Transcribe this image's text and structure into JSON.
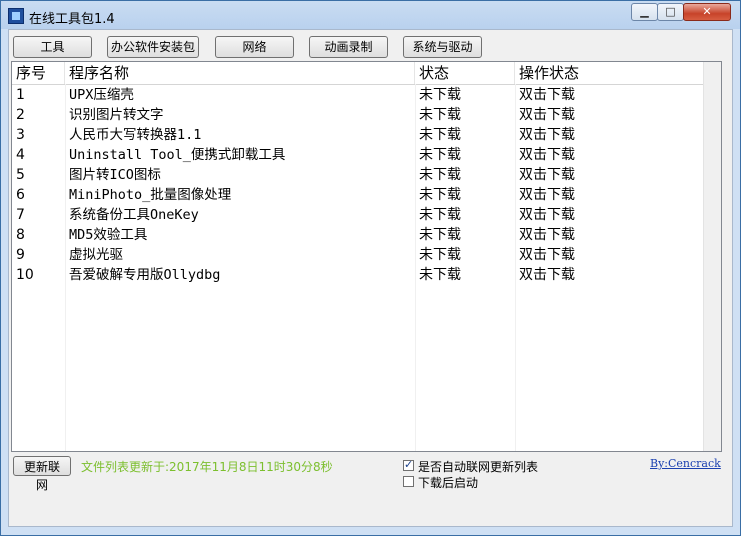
{
  "window": {
    "title": "在线工具包1.4",
    "min_label": "▁",
    "max_label": "□",
    "close_label": "✕"
  },
  "toolbar": {
    "tools": "工具",
    "office": "办公软件安装包",
    "network": "网络",
    "animation": "动画录制",
    "system": "系统与驱动"
  },
  "table": {
    "headers": [
      "序号",
      "程序名称",
      "状态",
      "操作状态"
    ],
    "rows": [
      [
        "1",
        "UPX压缩壳",
        "未下载",
        "双击下载"
      ],
      [
        "2",
        "识别图片转文字",
        "未下载",
        "双击下载"
      ],
      [
        "3",
        "人民币大写转换器1.1",
        "未下载",
        "双击下载"
      ],
      [
        "4",
        "Uninstall Tool_便携式卸载工具",
        "未下载",
        "双击下载"
      ],
      [
        "5",
        "图片转ICO图标",
        "未下载",
        "双击下载"
      ],
      [
        "6",
        "MiniPhoto_批量图像处理",
        "未下载",
        "双击下载"
      ],
      [
        "7",
        "系统备份工具OneKey",
        "未下载",
        "双击下载"
      ],
      [
        "8",
        "MD5效验工具",
        "未下载",
        "双击下载"
      ],
      [
        "9",
        "虚拟光驱",
        "未下载",
        "双击下载"
      ],
      [
        "10",
        "吾爱破解专用版Ollydbg",
        "未下载",
        "双击下载"
      ]
    ]
  },
  "footer": {
    "refresh_button": "更新联网",
    "updated_text": "文件列表更新于:2017年11月8日11时30分8秒",
    "auto_update_label": "是否自动联网更新列表",
    "auto_update_checked": true,
    "launch_after_label": "下载后启动",
    "launch_after_checked": false,
    "author": "By:Cencrack"
  },
  "colors": {
    "updated_text": "#7cbf2e",
    "author_link": "#1a3fb0"
  }
}
